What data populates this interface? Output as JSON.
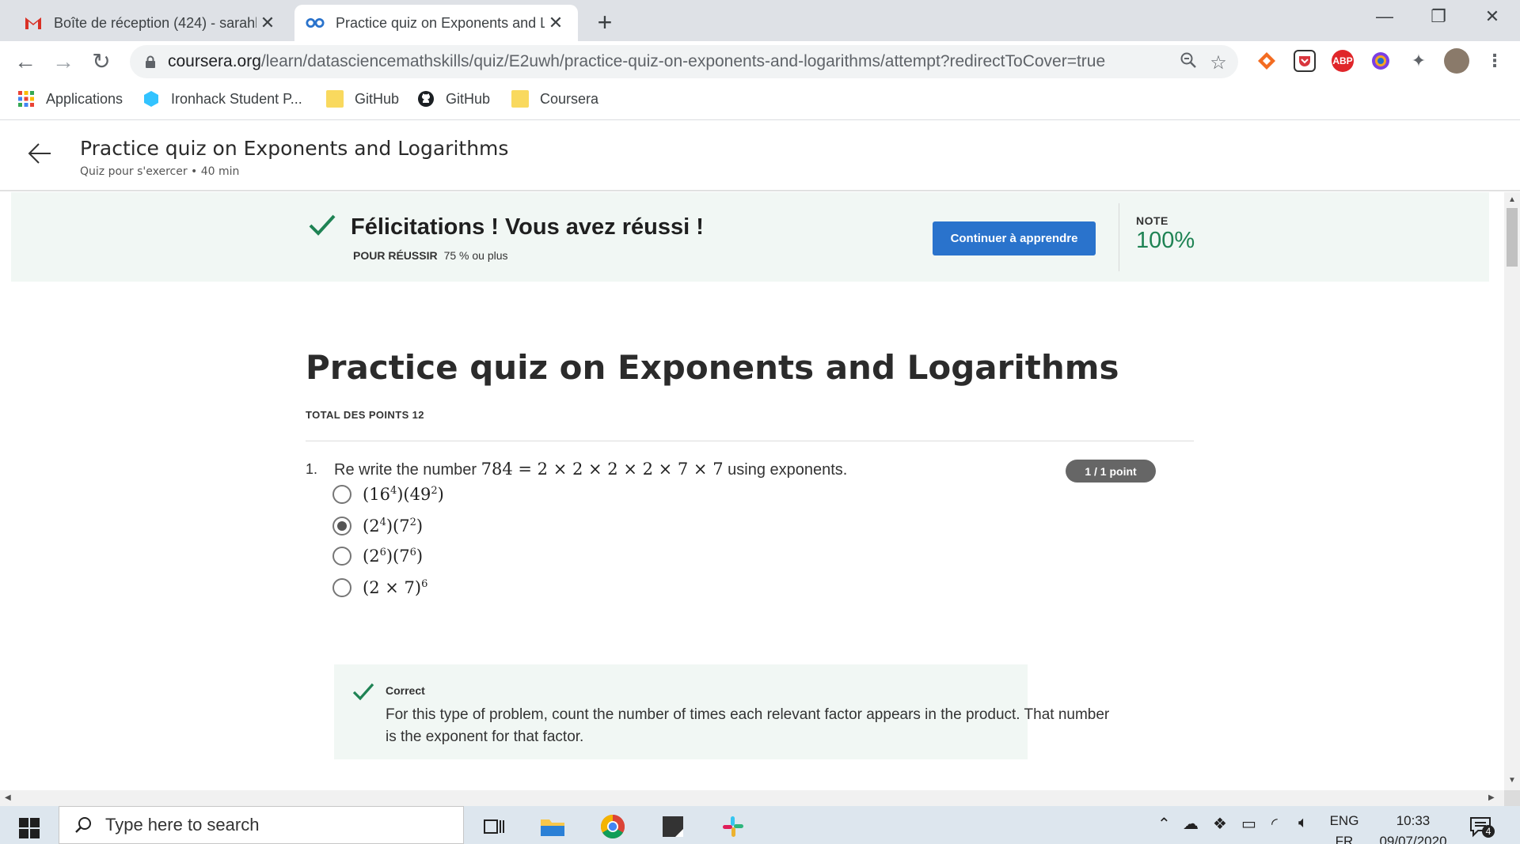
{
  "browser": {
    "tabs": [
      {
        "title": "Boîte de réception (424) - sarahb",
        "icon": "gmail-icon",
        "active": false
      },
      {
        "title": "Practice quiz on Exponents and L",
        "icon": "coursera-icon",
        "active": true
      }
    ],
    "url_host": "coursera.org",
    "url_path": "/learn/datasciencemathskills/quiz/E2uwh/practice-quiz-on-exponents-and-logarithms/attempt?redirectToCover=true",
    "bookmarks": [
      "Applications",
      "Ironhack Student P...",
      "GitHub",
      "GitHub",
      "Coursera"
    ],
    "extensions": {
      "abp": "ABP"
    }
  },
  "header": {
    "title": "Practice quiz on Exponents and Logarithms",
    "subtitle": "Quiz pour s'exercer • 40  min"
  },
  "banner": {
    "title": "Félicitations ! Vous avez réussi !",
    "pass_label": "POUR RÉUSSIR",
    "pass_value": "75 % ou plus",
    "button": "Continuer à apprendre",
    "note_label": "NOTE",
    "note_value": "100%"
  },
  "quiz": {
    "title": "Practice quiz on Exponents and Logarithms",
    "total_points": "TOTAL DES POINTS 12",
    "question": {
      "number": "1.",
      "text_before": "Re write the number ",
      "math": "784 = 2 × 2 × 2 × 2 × 7 × 7",
      "text_after": " using exponents.",
      "points": "1 / 1 point",
      "options": [
        {
          "base1": "16",
          "exp1": "4",
          "base2": "49",
          "exp2": "2",
          "selected": false
        },
        {
          "base1": "2",
          "exp1": "4",
          "base2": "7",
          "exp2": "2",
          "selected": true
        },
        {
          "base1": "2",
          "exp1": "6",
          "base2": "7",
          "exp2": "6",
          "selected": false
        },
        {
          "product": "2 × 7",
          "exp": "6",
          "selected": false
        }
      ],
      "feedback_label": "Correct",
      "feedback_text": "For this type of problem, count the number of times each relevant factor appears in the product. That number is the exponent for that factor."
    }
  },
  "taskbar": {
    "search_placeholder": "Type here to search",
    "lang_top": "ENG",
    "lang_bottom": "FR",
    "time": "10:33",
    "date": "09/07/2020",
    "notifications": "4"
  },
  "colors": {
    "accent_green": "#1f8354",
    "button_blue": "#2a73cc",
    "banner_bg": "#f1f7f4"
  }
}
